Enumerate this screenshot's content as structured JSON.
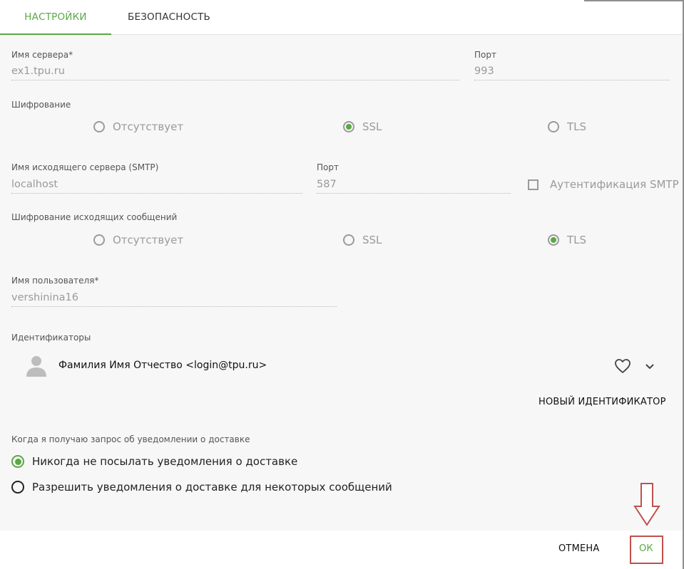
{
  "tabs": [
    {
      "label": "НАСТРОЙКИ",
      "active": true
    },
    {
      "label": "БЕЗОПАСНОСТЬ",
      "active": false
    }
  ],
  "incoming": {
    "server_label": "Имя сервера",
    "required_mark": "*",
    "server_value": "ex1.tpu.ru",
    "port_label": "Порт",
    "port_value": "993"
  },
  "encryption": {
    "label": "Шифрование",
    "options": [
      "Отсутствует",
      "SSL",
      "TLS"
    ],
    "selected": "SSL"
  },
  "outgoing": {
    "server_label": "Имя исходящего сервера (SMTP)",
    "server_value": "localhost",
    "port_label": "Порт",
    "port_value": "587",
    "auth_label": "Аутентификация SMTP",
    "auth_checked": false
  },
  "outgoing_encryption": {
    "label": "Шифрование исходящих сообщений",
    "options": [
      "Отсутствует",
      "SSL",
      "TLS"
    ],
    "selected": "TLS"
  },
  "user": {
    "label": "Имя пользователя",
    "required_mark": "*",
    "value": "vershinina16"
  },
  "identities": {
    "label": "Идентификаторы",
    "items": [
      {
        "display": "Фамилия Имя Отчество <login@tpu.ru>"
      }
    ],
    "new_button": "НОВЫЙ ИДЕНТИФИКАТОР"
  },
  "receipts": {
    "label": "Когда я получаю запрос об уведомлении о доставке",
    "options": [
      "Никогда не посылать уведомления о доставке",
      "Разрешить уведомления о доставке для некоторых сообщений"
    ],
    "selected_index": 0
  },
  "footer": {
    "cancel": "ОТМЕНА",
    "ok": "ОК"
  },
  "colors": {
    "accent": "#5aa845",
    "annotation": "#c0504d"
  }
}
